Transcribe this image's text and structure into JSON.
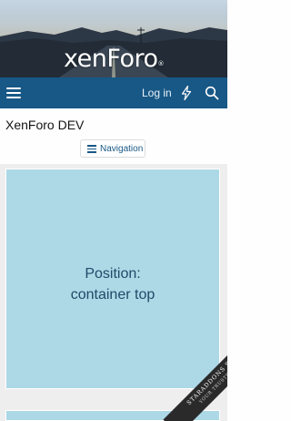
{
  "header": {
    "logo": {
      "text_main": "xenForo",
      "trademark": "®"
    }
  },
  "navbar": {
    "menu_icon": "hamburger-menu-icon",
    "login_label": "Log in",
    "whats_new_icon": "lightning-bolt-icon",
    "search_icon": "magnifier-icon",
    "background_color": "#185886"
  },
  "page": {
    "title": "XenForo DEV",
    "navigation_button": {
      "icon": "hamburger-menu-icon",
      "label": "Navigation"
    }
  },
  "ad_block": {
    "line1": "Position:",
    "line2": "container top",
    "background_color": "#add8e6"
  },
  "ribbon": {
    "title": "STARADDONS STORE",
    "subtitle": "YOUR TRUSTED HUB"
  }
}
